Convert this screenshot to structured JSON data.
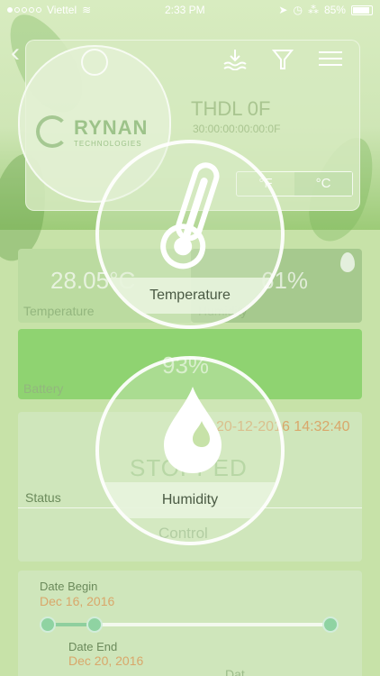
{
  "status_bar": {
    "carrier": "Viettel",
    "time": "2:33 PM",
    "battery": "85%"
  },
  "device": {
    "name": "THDL 0F",
    "id": "30:00:00:00:00:0F",
    "logo_name": "RYNAN",
    "logo_sub": "TECHNOLOGIES",
    "unit_c": "°C",
    "unit_f": "°F"
  },
  "readings": {
    "temperature_value": "28.05°C",
    "temperature_label": "Temperature",
    "humidity_value": "61%",
    "humidity_label": "Humidity",
    "battery_value": "93%",
    "battery_label": "Battery"
  },
  "status": {
    "time": "20-12-2016 14:32:40",
    "state": "STOPPED",
    "label": "Status",
    "control": "Control"
  },
  "dates": {
    "begin_label": "Date Begin",
    "begin_value": "Dec 16, 2016",
    "end_label": "Date End",
    "end_value": "Dec 20, 2016",
    "cut_label": "Dat"
  },
  "guide": {
    "temperature": "Temperature",
    "humidity": "Humidity"
  },
  "icons": [
    "back-icon",
    "water-level-icon",
    "filter-icon",
    "menu-icon",
    "thermometer-icon",
    "water-drop-icon"
  ],
  "colors": {
    "background": "#c7e2a8",
    "battery_panel": "#8fd371",
    "accent_text": "#d9a76a"
  }
}
